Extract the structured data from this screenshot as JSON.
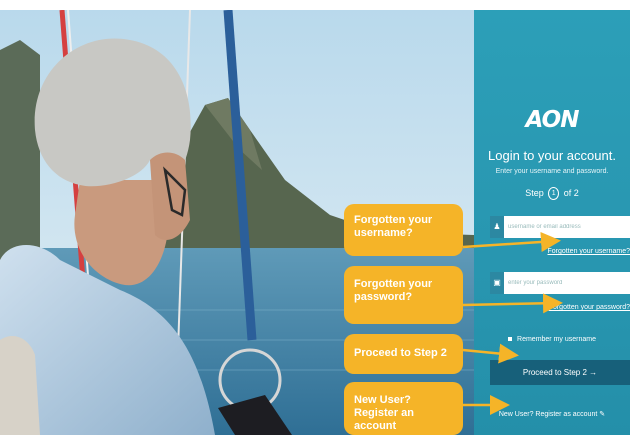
{
  "brand": {
    "logo": "AON"
  },
  "login": {
    "title": "Login to your account.",
    "subtitle": "Enter your username and password.",
    "step": {
      "prefix": "Step",
      "current": "1",
      "suffix": "of 2"
    },
    "username": {
      "placeholder": "username or email address",
      "icon": "person-icon"
    },
    "forgot_username": "Forgotten your username?",
    "password": {
      "placeholder": "enter your password",
      "icon": "lock-icon"
    },
    "forgot_password": "Forgotten your password?",
    "remember": "Remember my username",
    "proceed": {
      "label": "Proceed to Step 2",
      "arrow": "→"
    },
    "register": {
      "label": "New User? Register as account",
      "icon": "edit-icon"
    }
  },
  "callouts": [
    "Forgotten your username?",
    "Forgotten your password?",
    "Proceed to Step 2",
    "New User? Register an account"
  ],
  "colors": {
    "panel": "#2a9bb5",
    "callout": "#f5b428",
    "button": "#17607a"
  }
}
